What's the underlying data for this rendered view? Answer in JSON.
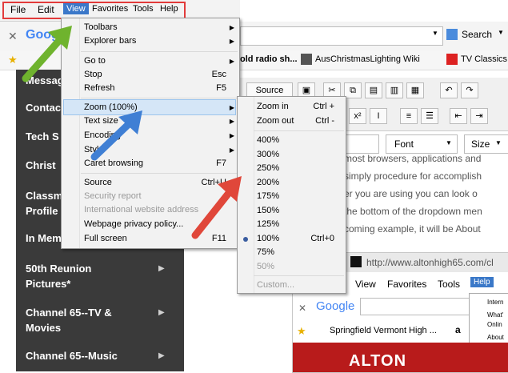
{
  "menubar": {
    "items": [
      "File",
      "Edit",
      "View",
      "Favorites",
      "Tools",
      "Help"
    ]
  },
  "view_menu": {
    "items": [
      {
        "label": "Toolbars",
        "shortcut": "",
        "submenu": true
      },
      {
        "label": "Explorer bars",
        "shortcut": "",
        "submenu": true
      },
      {
        "label": "Go to",
        "shortcut": "",
        "submenu": true
      },
      {
        "label": "Stop",
        "shortcut": "Esc"
      },
      {
        "label": "Refresh",
        "shortcut": "F5"
      },
      {
        "label": "Zoom (100%)",
        "shortcut": "",
        "submenu": true
      },
      {
        "label": "Text size",
        "shortcut": "",
        "submenu": true
      },
      {
        "label": "Encoding",
        "shortcut": "",
        "submenu": true
      },
      {
        "label": "Style",
        "shortcut": "",
        "submenu": true
      },
      {
        "label": "Caret browsing",
        "shortcut": "F7"
      },
      {
        "label": "Source",
        "shortcut": "Ctrl+U"
      },
      {
        "label": "Security report",
        "shortcut": "",
        "disabled": true
      },
      {
        "label": "International website address",
        "shortcut": "",
        "disabled": true
      },
      {
        "label": "Webpage privacy policy...",
        "shortcut": ""
      },
      {
        "label": "Full screen",
        "shortcut": "F11"
      }
    ]
  },
  "zoom_menu": {
    "items": [
      {
        "label": "Zoom in",
        "shortcut": "Ctrl +"
      },
      {
        "label": "Zoom out",
        "shortcut": "Ctrl -"
      },
      {
        "label": "400%",
        "shortcut": ""
      },
      {
        "label": "300%",
        "shortcut": ""
      },
      {
        "label": "250%",
        "shortcut": ""
      },
      {
        "label": "200%",
        "shortcut": ""
      },
      {
        "label": "175%",
        "shortcut": ""
      },
      {
        "label": "150%",
        "shortcut": ""
      },
      {
        "label": "125%",
        "shortcut": ""
      },
      {
        "label": "100%",
        "shortcut": "Ctrl+0",
        "selected": true
      },
      {
        "label": "75%",
        "shortcut": ""
      },
      {
        "label": "50%",
        "shortcut": "",
        "disabled": true
      },
      {
        "label": "Custom...",
        "shortcut": "",
        "disabled": true
      }
    ]
  },
  "browser": {
    "search_label": "Search",
    "favorites": [
      "old radio sh...",
      "AusChristmasLighting Wiki",
      "TV Classics"
    ],
    "google_text": "Google"
  },
  "left_nav": {
    "items": [
      "Message",
      "Contac",
      "Tech S",
      "Christ",
      "Classm Profile",
      "In Mem",
      "50th Reunion Pictures*",
      "Channel 65--TV & Movies",
      "Channel 65--Music"
    ]
  },
  "editor": {
    "source_label": "Source",
    "font_label": "Font",
    "size_label": "Size"
  },
  "content": {
    "lines": [
      "most browsers, applications and",
      "simply procedure for accomplish",
      "er you are using you can look o",
      "the bottom of the dropdown men",
      "coming example, it will be About"
    ]
  },
  "sub_browser": {
    "url": "http://www.altonhigh65.com/cl",
    "menu": [
      "View",
      "Favorites",
      "Tools",
      "Help"
    ],
    "google": "Google",
    "fav": "Springfield Vermont High ...",
    "help_items": [
      "Intern",
      "What'",
      "Onlin",
      "About"
    ],
    "banner": "ALTON"
  },
  "colors": {
    "highlight_box": "#e23b3b",
    "arrow_green": "#6fb32e",
    "arrow_blue": "#3f7fd4",
    "arrow_red": "#e0473a"
  }
}
